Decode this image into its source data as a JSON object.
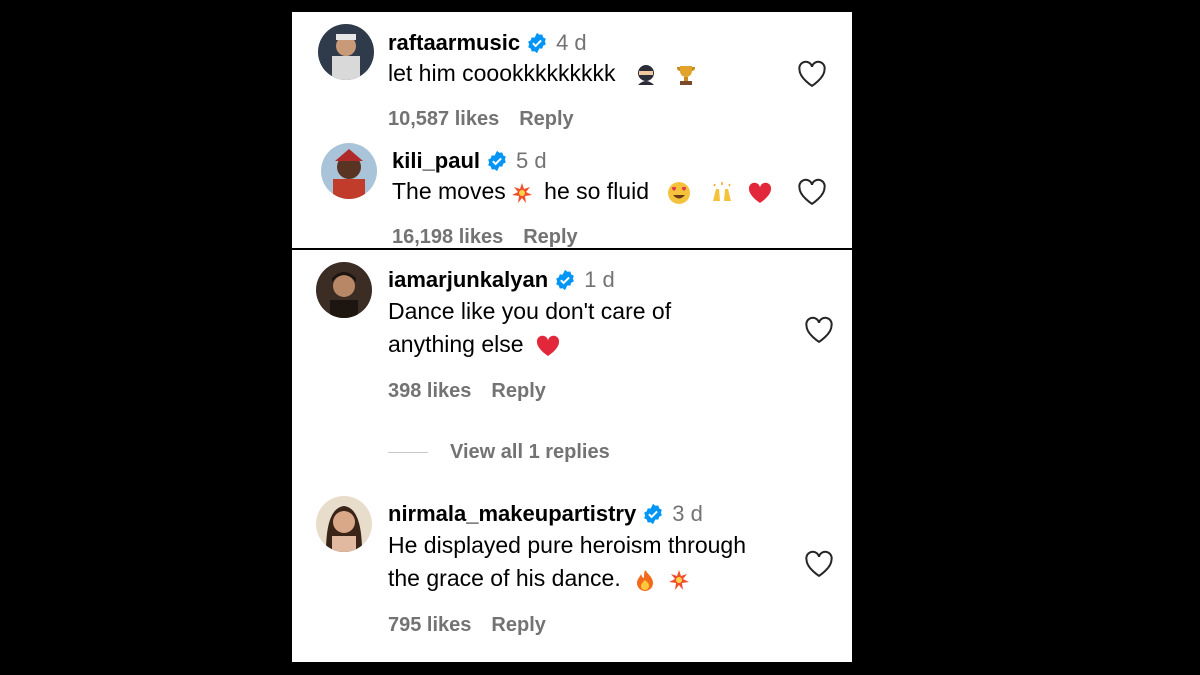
{
  "comments": [
    {
      "username": "raftaarmusic",
      "time": "4 d",
      "text_lines": [
        "let him coookkkkkkkkk"
      ],
      "likes": "10,587 likes",
      "reply": "Reply",
      "emoji": [
        "ninja-emoji",
        "trophy-emoji"
      ]
    },
    {
      "username": "kili_paul",
      "time": "5 d",
      "text_parts": [
        "The moves",
        "he so fluid"
      ],
      "likes": "16,198 likes",
      "reply": "Reply",
      "emoji": [
        "collision-emoji",
        "heart-eyes-emoji",
        "raising-hands-emoji",
        "red-heart-emoji"
      ]
    },
    {
      "username": "iamarjunkalyan",
      "time": "1 d",
      "text_lines": [
        "Dance like you don't care of",
        "anything else"
      ],
      "likes": "398 likes",
      "reply": "Reply",
      "view_replies": "View all 1 replies",
      "emoji": [
        "red-heart-emoji"
      ]
    },
    {
      "username": "nirmala_makeupartistry",
      "time": "3 d",
      "text_lines": [
        "He displayed pure heroism through",
        "the grace of his dance."
      ],
      "likes": "795 likes",
      "reply": "Reply",
      "emoji": [
        "fire-emoji",
        "collision-emoji"
      ]
    }
  ],
  "colors": {
    "verified": "#0095f6",
    "secondary": "#737373",
    "background": "#000000"
  }
}
